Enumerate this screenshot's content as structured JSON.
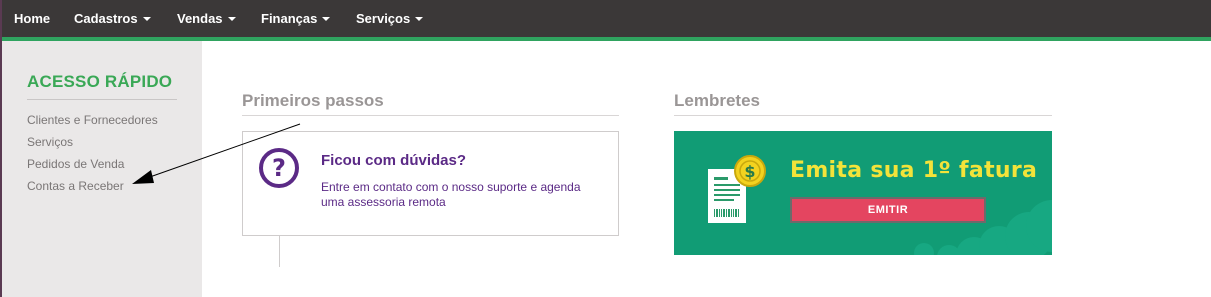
{
  "nav": {
    "items": [
      {
        "label": "Home",
        "dropdown": false
      },
      {
        "label": "Cadastros",
        "dropdown": true
      },
      {
        "label": "Vendas",
        "dropdown": true
      },
      {
        "label": "Finanças",
        "dropdown": true
      },
      {
        "label": "Serviços",
        "dropdown": true
      }
    ],
    "background": "#3b3838",
    "accent": "#2fa35f"
  },
  "sidebar": {
    "title": "ACESSO RÁPIDO",
    "links": [
      {
        "label": "Clientes e Fornecedores"
      },
      {
        "label": "Serviços"
      },
      {
        "label": "Pedidos de Venda"
      },
      {
        "label": "Contas a Receber"
      }
    ]
  },
  "primeiros_passos": {
    "title": "Primeiros passos",
    "card": {
      "icon": "question-circle-icon",
      "title": "Ficou com dúvidas?",
      "text": "Entre em contato com o nosso suporte e agenda uma assessoria remota"
    }
  },
  "lembretes": {
    "title": "Lembretes",
    "banner": {
      "title": "Emita sua 1º fatura",
      "button_label": "EMITIR",
      "icon": "invoice-dollar-icon",
      "background": "#119c75",
      "title_color": "#f3e33a",
      "button_color": "#e44560"
    }
  }
}
